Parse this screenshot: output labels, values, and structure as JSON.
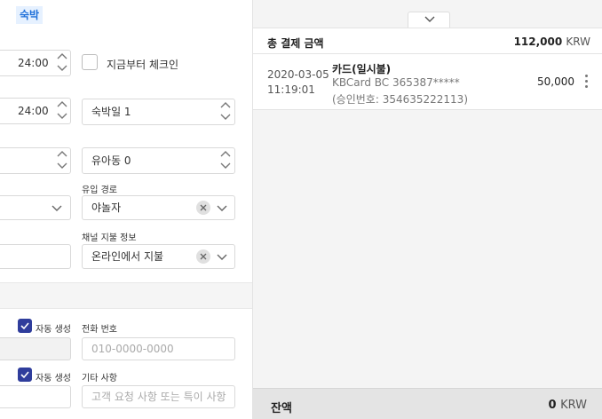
{
  "section": {
    "tag": "숙박"
  },
  "form": {
    "checkin_time": "24:00",
    "checkout_time": "24:00",
    "pay_from_now_label": "지금부터 체크인",
    "nights": "숙박일 1",
    "infants": "유아동 0",
    "inflow_label": "유입 경로",
    "inflow_value": "야놀자",
    "channel_pay_label": "채널 지불 정보",
    "channel_pay_value": "온라인에서 지불",
    "auto_gen_label_1": "자동 생성",
    "auto_gen_label_2": "자동 생성",
    "phone_label": "전화 번호",
    "phone_placeholder": "010-0000-0000",
    "etc_label": "기타 사항",
    "etc_placeholder": "고객 요청 사항 또는 특이 사항"
  },
  "payment": {
    "total_label": "총 결제 금액",
    "total_amount": "112,000",
    "currency": "KRW",
    "items": [
      {
        "date": "2020-03-05",
        "time": "11:19:01",
        "method": "카드(일시불)",
        "card": "KBCard BC 365387*****",
        "approval": "(승인번호: 354635222113)",
        "amount": "50,000"
      }
    ],
    "balance_label": "잔액",
    "balance_amount": "0",
    "balance_currency": "KRW"
  },
  "colors": {
    "accent": "#2f3d9c",
    "tag_bg": "#e6f1ff",
    "tag_text": "#1e6fd9"
  }
}
